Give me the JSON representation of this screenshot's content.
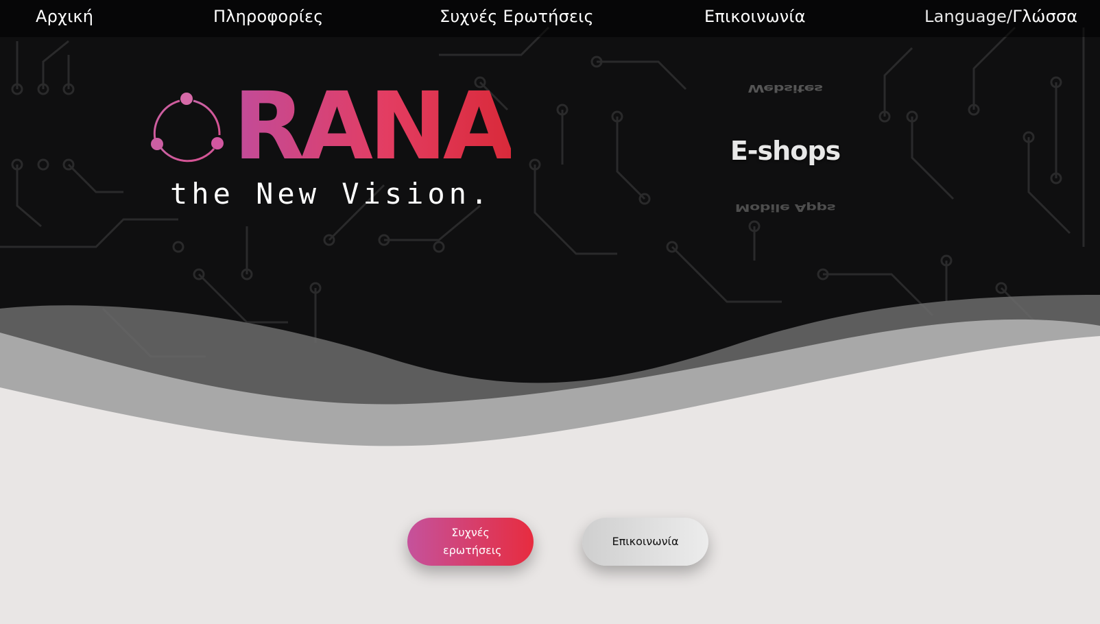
{
  "nav": {
    "home": "Αρχική",
    "info": "Πληροφορίες",
    "faq": "Συχνές Ερωτήσεις",
    "contact": "Επικοινωνία",
    "language_prefix": "Language/",
    "language_greek": "Γλώσσα"
  },
  "hero": {
    "brand_word": "RANA",
    "tagline": "the New Vision.",
    "rotator": {
      "previous": "Websites",
      "current": "E-shops",
      "next": "Mobile Apps"
    }
  },
  "buttons": {
    "faq": "Συχνές ερωτήσεις",
    "contact": "Επικοινωνία"
  },
  "colors": {
    "hero_bg": "#0f0f10",
    "accent_start": "#c5529c",
    "accent_end": "#e72c3f",
    "page_bg": "#e9e6e5"
  }
}
